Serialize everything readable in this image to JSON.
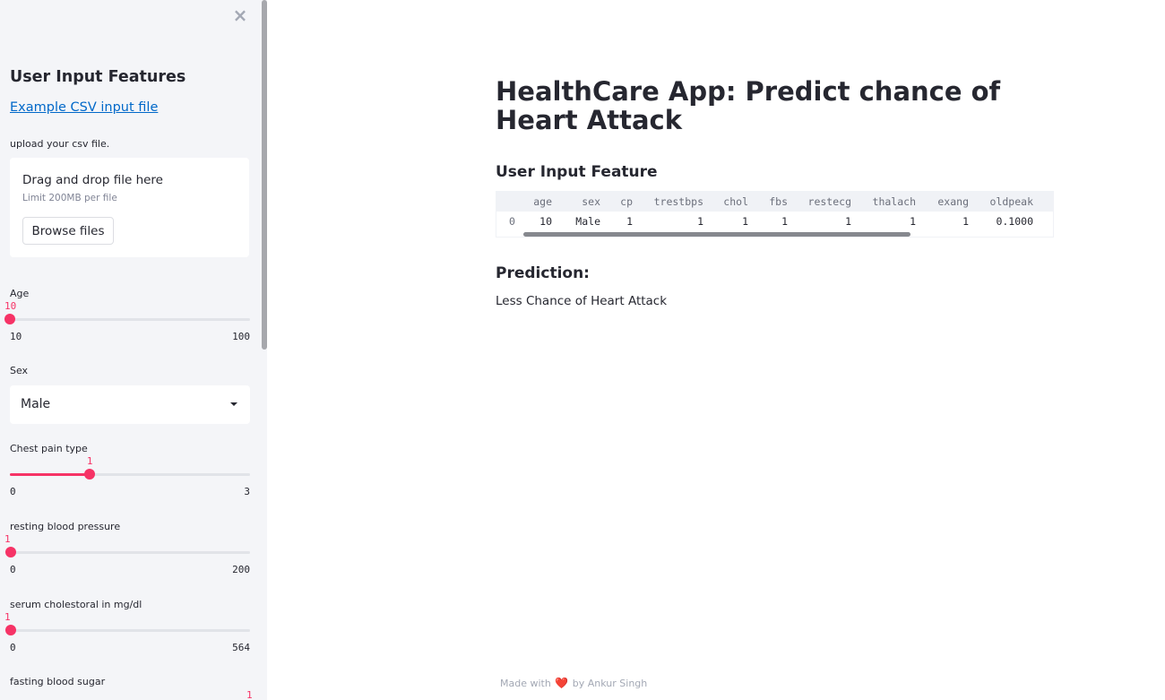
{
  "sidebar": {
    "close_glyph": "×",
    "title": "User Input Features",
    "csv_link": "Example CSV input file",
    "upload_label": "upload your csv file.",
    "uploader": {
      "drag_title": "Drag and drop file here",
      "limit": "Limit 200MB per file",
      "browse_label": "Browse files"
    },
    "age": {
      "label": "Age",
      "value": "10",
      "min": "10",
      "max": "100",
      "fraction": 0.0
    },
    "sex": {
      "label": "Sex",
      "value": "Male"
    },
    "chest_pain": {
      "label": "Chest pain type",
      "value": "1",
      "min": "0",
      "max": "3",
      "fraction": 0.333
    },
    "blood_pressure": {
      "label": "resting blood pressure",
      "value": "1",
      "min": "0",
      "max": "200",
      "fraction": 0.005
    },
    "cholesterol": {
      "label": "serum cholestoral in mg/dl",
      "value": "1",
      "min": "0",
      "max": "564",
      "fraction": 0.002
    },
    "fasting_sugar": {
      "label": "fasting blood sugar",
      "value": "1"
    }
  },
  "main": {
    "title": "HealthCare App: Predict chance of Heart Attack",
    "feature_heading": "User Input Feature",
    "table": {
      "columns": [
        "age",
        "sex",
        "cp",
        "trestbps",
        "chol",
        "fbs",
        "restecg",
        "thalach",
        "exang",
        "oldpeak"
      ],
      "rows": [
        {
          "index": "0",
          "cells": [
            "10",
            "Male",
            "1",
            "1",
            "1",
            "1",
            "1",
            "1",
            "1",
            "0.1000"
          ]
        }
      ]
    },
    "prediction_heading": "Prediction:",
    "prediction_text": "Less Chance of Heart Attack"
  },
  "footer": {
    "made_with": "Made with",
    "heart": "❤️",
    "by": "by Ankur Singh"
  },
  "colors": {
    "accent": "#f63366",
    "link": "#0068c9",
    "sidebar_bg": "#f4f5f8"
  }
}
